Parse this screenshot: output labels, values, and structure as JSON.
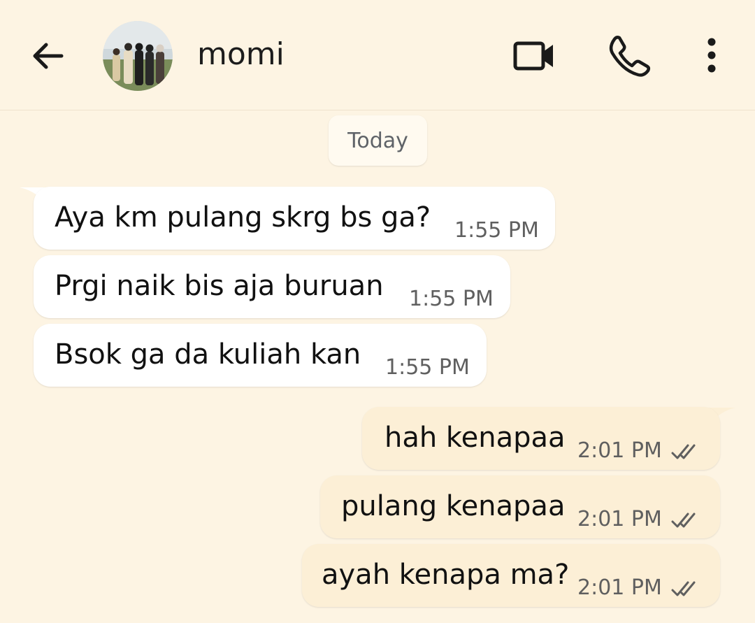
{
  "header": {
    "contact_name": "momi",
    "icons": [
      "back-arrow-icon",
      "avatar",
      "video-call-icon",
      "phone-icon",
      "more-vert-icon"
    ]
  },
  "chat": {
    "day_separator": "Today",
    "messages": [
      {
        "direction": "incoming",
        "text": "Aya km pulang skrg bs ga?",
        "time": "1:55 PM"
      },
      {
        "direction": "incoming",
        "text": "Prgi naik bis aja buruan",
        "time": "1:55 PM"
      },
      {
        "direction": "incoming",
        "text": "Bsok ga da kuliah kan",
        "time": "1:55 PM"
      },
      {
        "direction": "outgoing",
        "text": "hah kenapaa",
        "time": "2:01 PM",
        "status": "read-double-check-icon"
      },
      {
        "direction": "outgoing",
        "text": "pulang kenapaa",
        "time": "2:01 PM",
        "status": "read-double-check-icon"
      },
      {
        "direction": "outgoing",
        "text": "ayah kenapa ma?",
        "time": "2:01 PM",
        "status": "read-double-check-icon"
      }
    ]
  },
  "colors": {
    "background": "#fdf4e3",
    "incoming_bubble": "#ffffff",
    "outgoing_bubble": "#fcefd6",
    "timestamp": "#5f5f5f"
  }
}
